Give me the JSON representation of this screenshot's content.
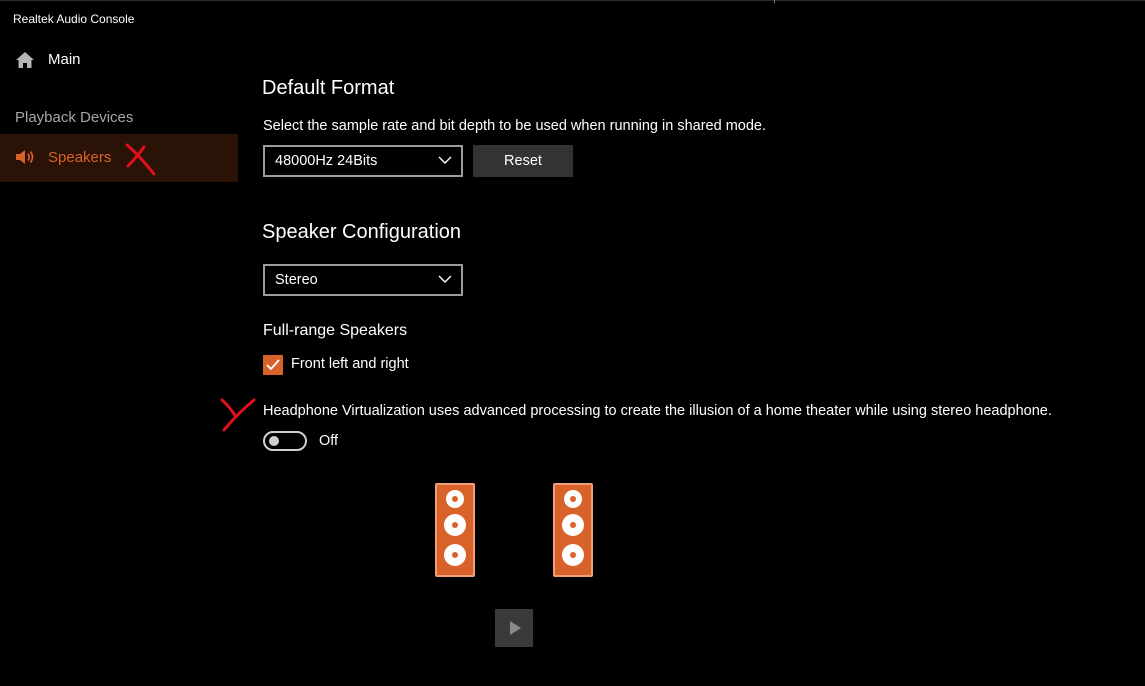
{
  "window": {
    "title": "Realtek Audio Console"
  },
  "sidebar": {
    "main_label": "Main",
    "section_label": "Playback Devices",
    "speakers_label": "Speakers"
  },
  "default_format": {
    "heading": "Default Format",
    "description": "Select the sample rate and bit depth to be used when running in shared mode.",
    "selected": "48000Hz 24Bits",
    "reset_label": "Reset"
  },
  "speaker_config": {
    "heading": "Speaker Configuration",
    "selected": "Stereo"
  },
  "full_range": {
    "heading": "Full-range Speakers",
    "checkbox_label": "Front left and right",
    "checked": true
  },
  "headphone_virtualization": {
    "description": "Headphone Virtualization uses advanced processing to create the illusion of a home theater while using stereo headphone.",
    "state_label": "Off",
    "enabled": false
  },
  "colors": {
    "accent": "#d9622b",
    "selected_bg": "#2a1206",
    "background": "#000000",
    "annotation": "#e0101a"
  },
  "icons": [
    "home-icon",
    "speaker-volume-icon",
    "chevron-down-icon",
    "checkmark-icon",
    "play-icon"
  ]
}
